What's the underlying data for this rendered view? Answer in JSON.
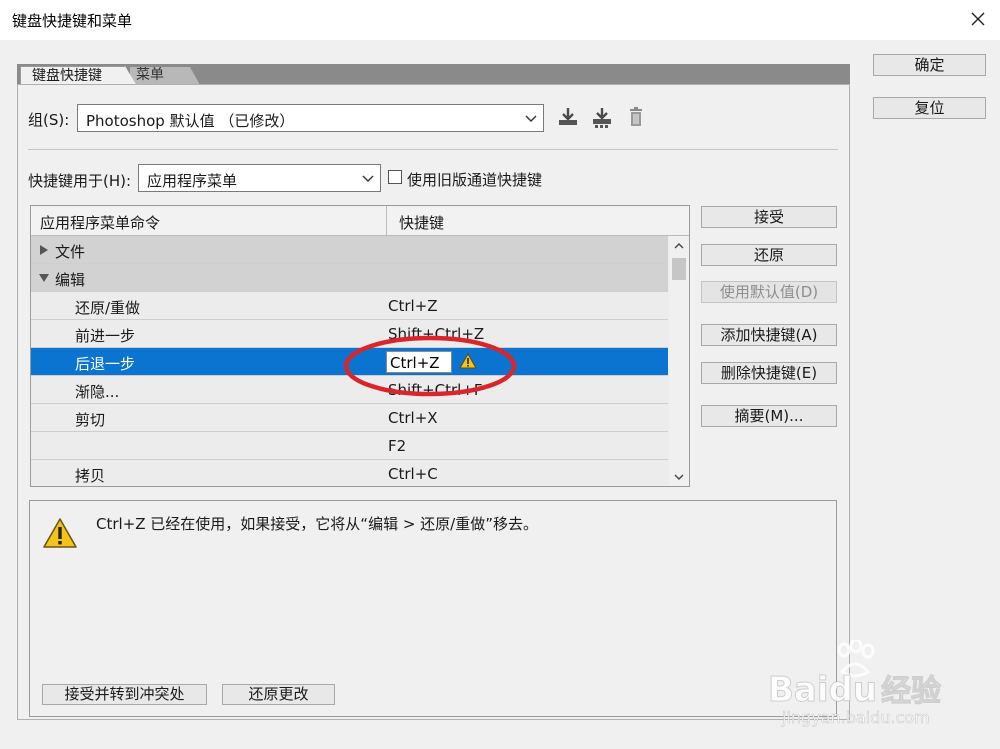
{
  "window": {
    "title": "键盘快捷键和菜单"
  },
  "dialog_buttons": {
    "ok": "确定",
    "reset": "复位"
  },
  "tabs": {
    "keyboard": "键盘快捷键",
    "menu": "菜单"
  },
  "set_row": {
    "label": "组(S):",
    "value": "Photoshop 默认值 （已修改）",
    "icons": [
      "save-set-icon",
      "save-as-icon",
      "delete-set-icon"
    ]
  },
  "shortcuts_for": {
    "label": "快捷键用于(H):",
    "value": "应用程序菜单",
    "legacy_checkbox_label": "使用旧版通道快捷键",
    "legacy_checked": false
  },
  "table": {
    "col_command": "应用程序菜单命令",
    "col_shortcut": "快捷键",
    "rows": [
      {
        "command": "文件",
        "shortcut": "",
        "type": "group",
        "expanded": false
      },
      {
        "command": "编辑",
        "shortcut": "",
        "type": "group",
        "expanded": true
      },
      {
        "command": "还原/重做",
        "shortcut": "Ctrl+Z",
        "type": "item"
      },
      {
        "command": "前进一步",
        "shortcut": "Shift+Ctrl+Z",
        "type": "item"
      },
      {
        "command": "后退一步",
        "shortcut": "",
        "type": "item",
        "selected": true,
        "editing_value": "Ctrl+Z"
      },
      {
        "command": "渐隐...",
        "shortcut": "Shift+Ctrl+F",
        "type": "item"
      },
      {
        "command": "剪切",
        "shortcut": "Ctrl+X",
        "type": "item"
      },
      {
        "command": "",
        "shortcut": "F2",
        "type": "item"
      },
      {
        "command": "拷贝",
        "shortcut": "Ctrl+C",
        "type": "item"
      }
    ]
  },
  "side_buttons": {
    "accept": "接受",
    "undo": "还原",
    "use_default": "使用默认值(D)",
    "add_shortcut": "添加快捷键(A)",
    "delete_shortcut": "删除快捷键(E)",
    "summary": "摘要(M)..."
  },
  "message": {
    "text": "Ctrl+Z 已经在使用，如果接受，它将从“编辑 > 还原/重做”移去。",
    "accept_goto_conflict": "接受并转到冲突处",
    "undo_changes": "还原更改"
  },
  "watermark": {
    "brand": "Bai",
    "brand2": "du",
    "brand_cn": "经验",
    "url": "jingyan.baidu.com"
  },
  "colors": {
    "selection": "#0b74d1",
    "annotation": "#d9252b",
    "warning": "#f2c31a"
  }
}
